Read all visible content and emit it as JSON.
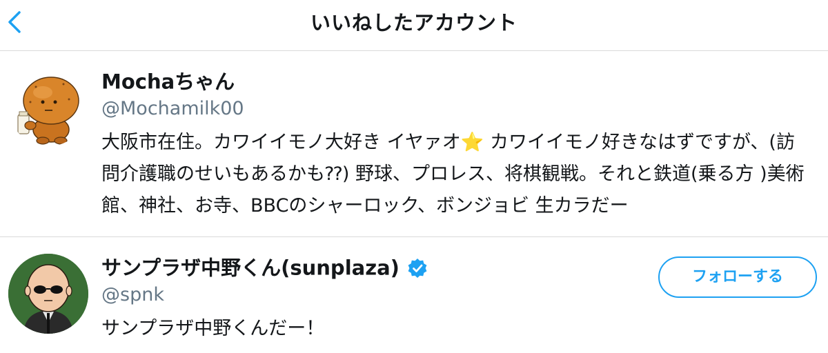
{
  "header": {
    "title": "いいねしたアカウント",
    "back_icon": "chevron-left-icon"
  },
  "colors": {
    "accent": "#1da1f2",
    "secondary_text": "#657786",
    "divider": "#d9d9d9"
  },
  "accounts": [
    {
      "display_name": "Mochaちゃん",
      "handle": "@Mochamilk00",
      "bio": "大阪市在住。カワイイモノ大好き イヤァオ⭐️ カワイイモノ好きなはずですが、(訪問介護職のせいもあるかも⁇) 野球、プロレス、将棋観戦。それと鉄道(乗る方 )美術館、神社、お寺、BBCのシャーロック、ボンジョビ 生カラだー",
      "verified": false
    },
    {
      "display_name": "サンプラザ中野くん(sunplaza)",
      "handle": "@spnk",
      "bio": "サンプラザ中野くんだー！",
      "verified": true,
      "follow_label": "フォローする"
    }
  ]
}
